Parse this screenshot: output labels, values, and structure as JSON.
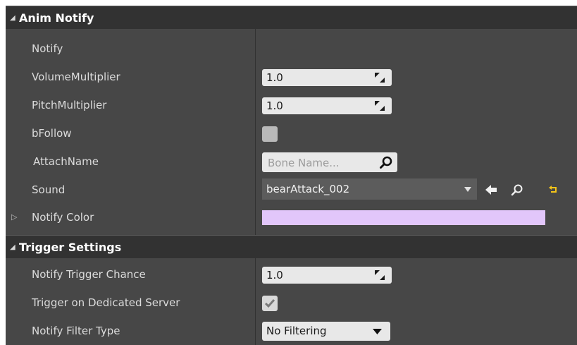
{
  "anim_notify": {
    "title": "Anim Notify",
    "notify_label": "Notify",
    "volume_label": "VolumeMultiplier",
    "volume_value": "1.0",
    "pitch_label": "PitchMultiplier",
    "pitch_value": "1.0",
    "follow_label": "bFollow",
    "follow_checked": false,
    "attach_label": "AttachName",
    "attach_placeholder": "Bone Name...",
    "sound_label": "Sound",
    "sound_value": "bearAttack_002",
    "color_label": "Notify Color",
    "color_value": "#e2c6fa"
  },
  "trigger_settings": {
    "title": "Trigger Settings",
    "chance_label": "Notify Trigger Chance",
    "chance_value": "1.0",
    "server_label": "Trigger on Dedicated Server",
    "server_checked": true,
    "filter_label": "Notify Filter Type",
    "filter_value": "No Filtering"
  },
  "icons": {
    "collapse": "collapse-triangle-icon",
    "expand": "expand-triangle-icon",
    "spin": "spin-arrows-icon",
    "search": "magnifier-icon",
    "use_selected": "left-arrow-icon",
    "browse": "browse-search-icon",
    "reset": "reset-arrow-icon",
    "check": "checkmark-icon",
    "dropdown": "chevron-down-icon"
  },
  "colors": {
    "panel_bg": "#474747",
    "header_bg": "#323232",
    "field_bg": "#e8e8e8",
    "reset_yellow": "#f5c518"
  }
}
